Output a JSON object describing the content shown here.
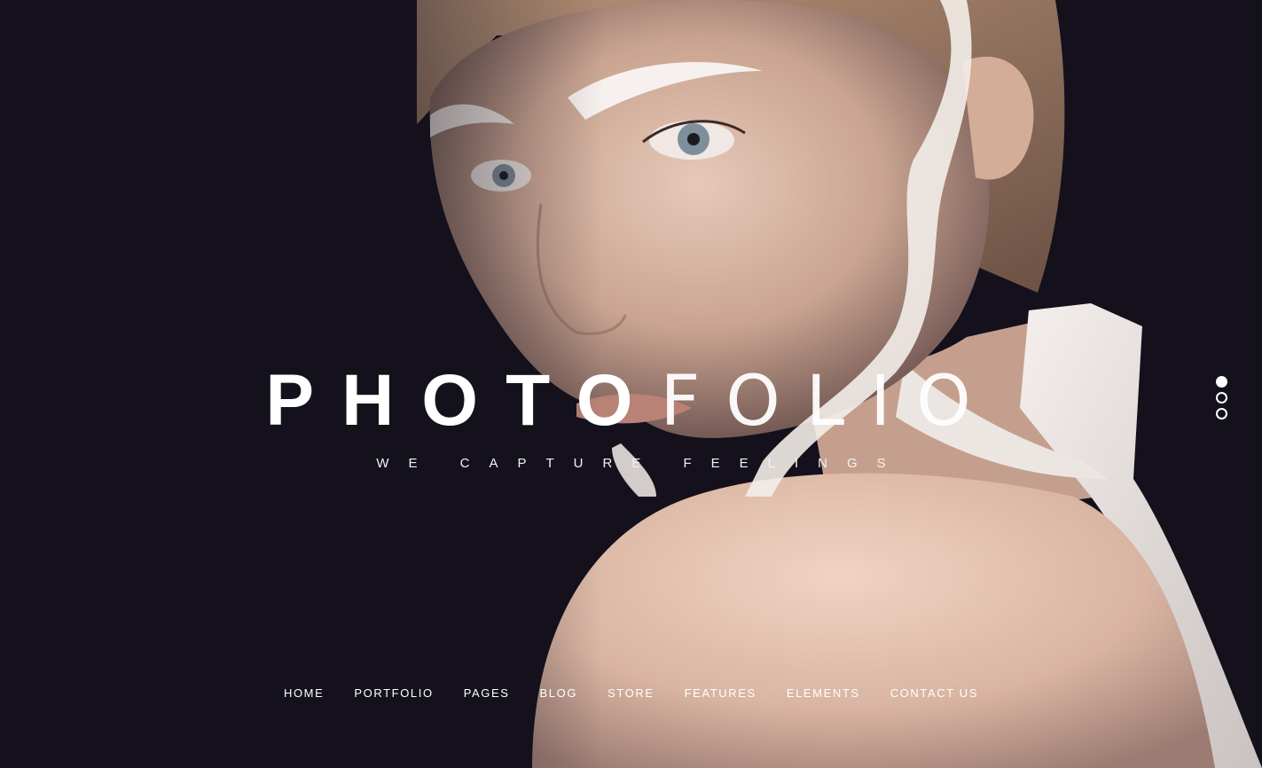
{
  "hero": {
    "title_strong": "PHOTO",
    "title_light": "FOLIO",
    "tagline": "WE CAPTURE FEELINGS",
    "background_color": "#14111c"
  },
  "slider": {
    "dots": [
      {
        "state": "active"
      },
      {
        "state": "inactive"
      },
      {
        "state": "inactive"
      }
    ]
  },
  "nav": {
    "items": [
      {
        "label": "HOME"
      },
      {
        "label": "PORTFOLIO"
      },
      {
        "label": "PAGES"
      },
      {
        "label": "BLOG"
      },
      {
        "label": "STORE"
      },
      {
        "label": "FEATURES"
      },
      {
        "label": "ELEMENTS"
      },
      {
        "label": "CONTACT US"
      }
    ]
  }
}
